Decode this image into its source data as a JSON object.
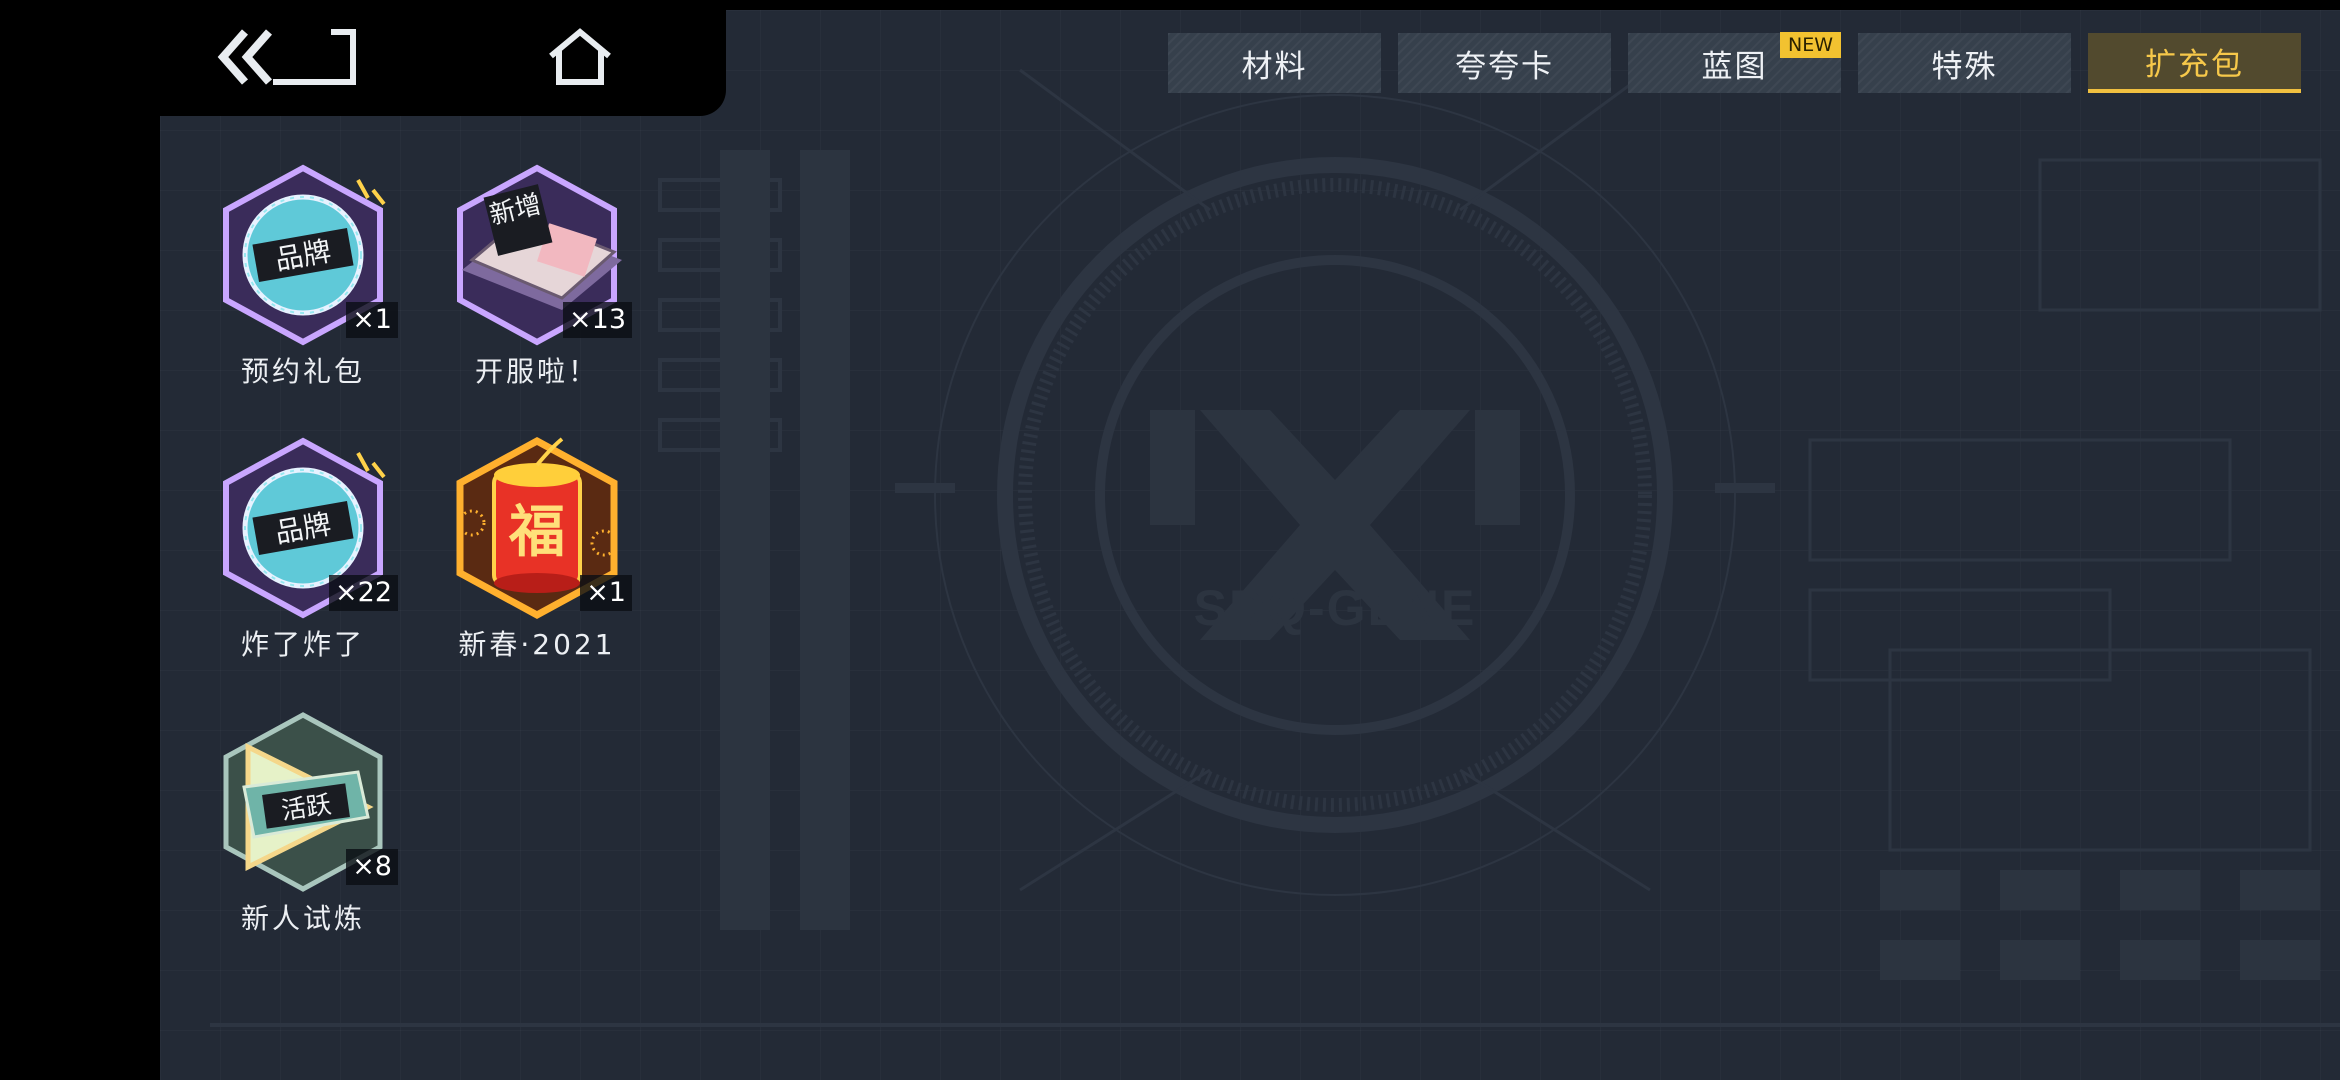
{
  "nav": {
    "back_icon": "double-chevron-left-back-icon",
    "home_icon": "home-icon"
  },
  "tabs": [
    {
      "label": "材料",
      "active": false
    },
    {
      "label": "夸夸卡",
      "active": false
    },
    {
      "label": "蓝图",
      "active": false,
      "badge": "NEW"
    },
    {
      "label": "特殊",
      "active": false
    },
    {
      "label": "扩充包",
      "active": true
    }
  ],
  "items": [
    {
      "name": "预约礼包",
      "count": "×1",
      "icon": "brand-badge-icon",
      "icon_text": "品牌"
    },
    {
      "name": "开服啦！",
      "count": "×13",
      "icon": "new-box-icon",
      "icon_text": "新增"
    },
    {
      "name": "炸了炸了",
      "count": "×22",
      "icon": "brand-badge-icon",
      "icon_text": "品牌"
    },
    {
      "name": "新春·2021",
      "count": "×1",
      "icon": "firecracker-fu-icon",
      "icon_text": "福"
    },
    {
      "name": "新人试炼",
      "count": "×8",
      "icon": "active-triangle-icon",
      "icon_text": "活跃"
    }
  ],
  "background": {
    "logo_text": "SDQ-GENE"
  },
  "colors": {
    "panel": "#232a36",
    "tab": "#36404c",
    "tab_active_text": "#f6c84a",
    "accent_gold": "#f0c040",
    "badge": "#f2c230"
  }
}
